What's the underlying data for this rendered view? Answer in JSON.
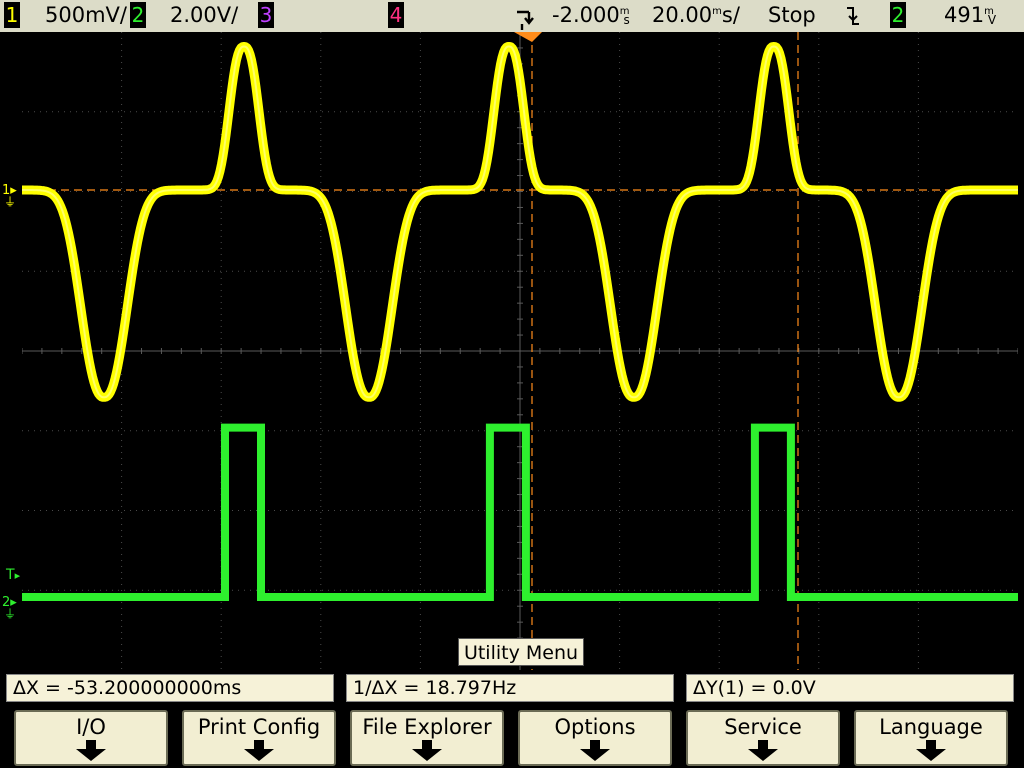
{
  "status_bar": {
    "ch1_number": "1",
    "ch1_scale": "500",
    "ch1_scale_unit": "mV/",
    "ch2_number": "2",
    "ch2_scale": "2.00V/",
    "ch3_number": "3",
    "ch4_number": "4",
    "time_delay": "-2.000",
    "time_delay_unit": "s",
    "time_delay_prefix": "m",
    "time_scale": "20.00",
    "time_scale_unit": "s/",
    "time_scale_prefix": "m",
    "run_state": "Stop",
    "trigger_source": "2",
    "trigger_level": "491",
    "trigger_level_unit": "V",
    "trigger_level_prefix": "m"
  },
  "markers": {
    "ch1_ground": "1",
    "ch2_ground": "2",
    "trigger_level_marker": "T"
  },
  "menu_title": "Utility Menu",
  "measurements": {
    "delta_x": "ΔX = -53.200000000ms",
    "inv_delta_x": "1/ΔX = 18.797Hz",
    "delta_y": "ΔY(1) = 0.0V"
  },
  "softkeys": [
    {
      "label": "I/O"
    },
    {
      "label": "Print Config"
    },
    {
      "label": "File Explorer"
    },
    {
      "label": "Options"
    },
    {
      "label": "Service"
    },
    {
      "label": "Language"
    }
  ],
  "colors": {
    "ch1": "#ffff00",
    "ch2": "#2ef02e",
    "ch3": "#c040ff",
    "ch4": "#ff3080",
    "cursor": "#ff8c1a",
    "grid": "#555555",
    "panel": "#dcdcc8"
  },
  "chart_data": {
    "type": "line",
    "time_per_div_ms": 20,
    "horizontal_divisions": 10,
    "vertical_divisions": 8,
    "trigger_delay_ms": -2.0,
    "cursor_delta_x_ms": -53.2,
    "series": [
      {
        "name": "1",
        "scale_per_div": "500mV",
        "pulse_period_ms": 53.2,
        "positive_peak_height_div": 1.8,
        "negative_trough_depth_div": 2.6
      },
      {
        "name": "2",
        "scale_per_div": "2.00V",
        "pulse_period_ms": 53.2,
        "pulse_high_div": 2.6
      }
    ]
  }
}
